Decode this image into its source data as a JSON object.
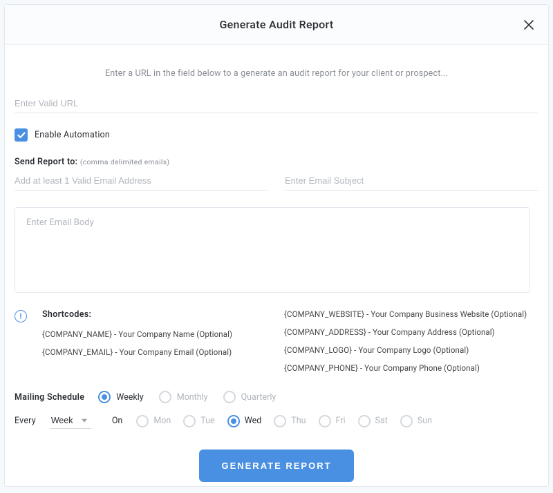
{
  "header": {
    "title": "Generate Audit Report"
  },
  "intro": "Enter a URL in the field below to a generate an audit report for your client or prospect...",
  "url": {
    "placeholder": "Enter Valid URL",
    "value": ""
  },
  "automation": {
    "enabled": true,
    "label": "Enable Automation"
  },
  "send_to": {
    "label": "Send Report to:",
    "hint": "(comma delimited emails)",
    "emails_placeholder": "Add at least 1 Valid Email Address",
    "subject_placeholder": "Enter Email Subject"
  },
  "body": {
    "placeholder": "Enter Email Body"
  },
  "shortcodes": {
    "title": "Shortcodes:",
    "left": [
      "{COMPANY_NAME} - Your Company Name (Optional)",
      "{COMPANY_EMAIL} - Your Company Email (Optional)"
    ],
    "right": [
      "{COMPANY_WEBSITE} - Your Company Business Website (Optional)",
      "{COMPANY_ADDRESS} - Your Company Address (Optional)",
      "{COMPANY_LOGO} - Your Company Logo (Optional)",
      "{COMPANY_PHONE} - Your Company Phone (Optional)"
    ]
  },
  "schedule": {
    "label": "Mailing Schedule",
    "options": [
      "Weekly",
      "Monthly",
      "Quarterly"
    ],
    "selected": "Weekly"
  },
  "every": {
    "label": "Every",
    "unit": "Week",
    "on_label": "On",
    "days": [
      "Mon",
      "Tue",
      "Wed",
      "Thu",
      "Fri",
      "Sat",
      "Sun"
    ],
    "selected_day": "Wed"
  },
  "button": {
    "label": "GENERATE REPORT"
  },
  "colors": {
    "accent": "#4a90e2"
  }
}
